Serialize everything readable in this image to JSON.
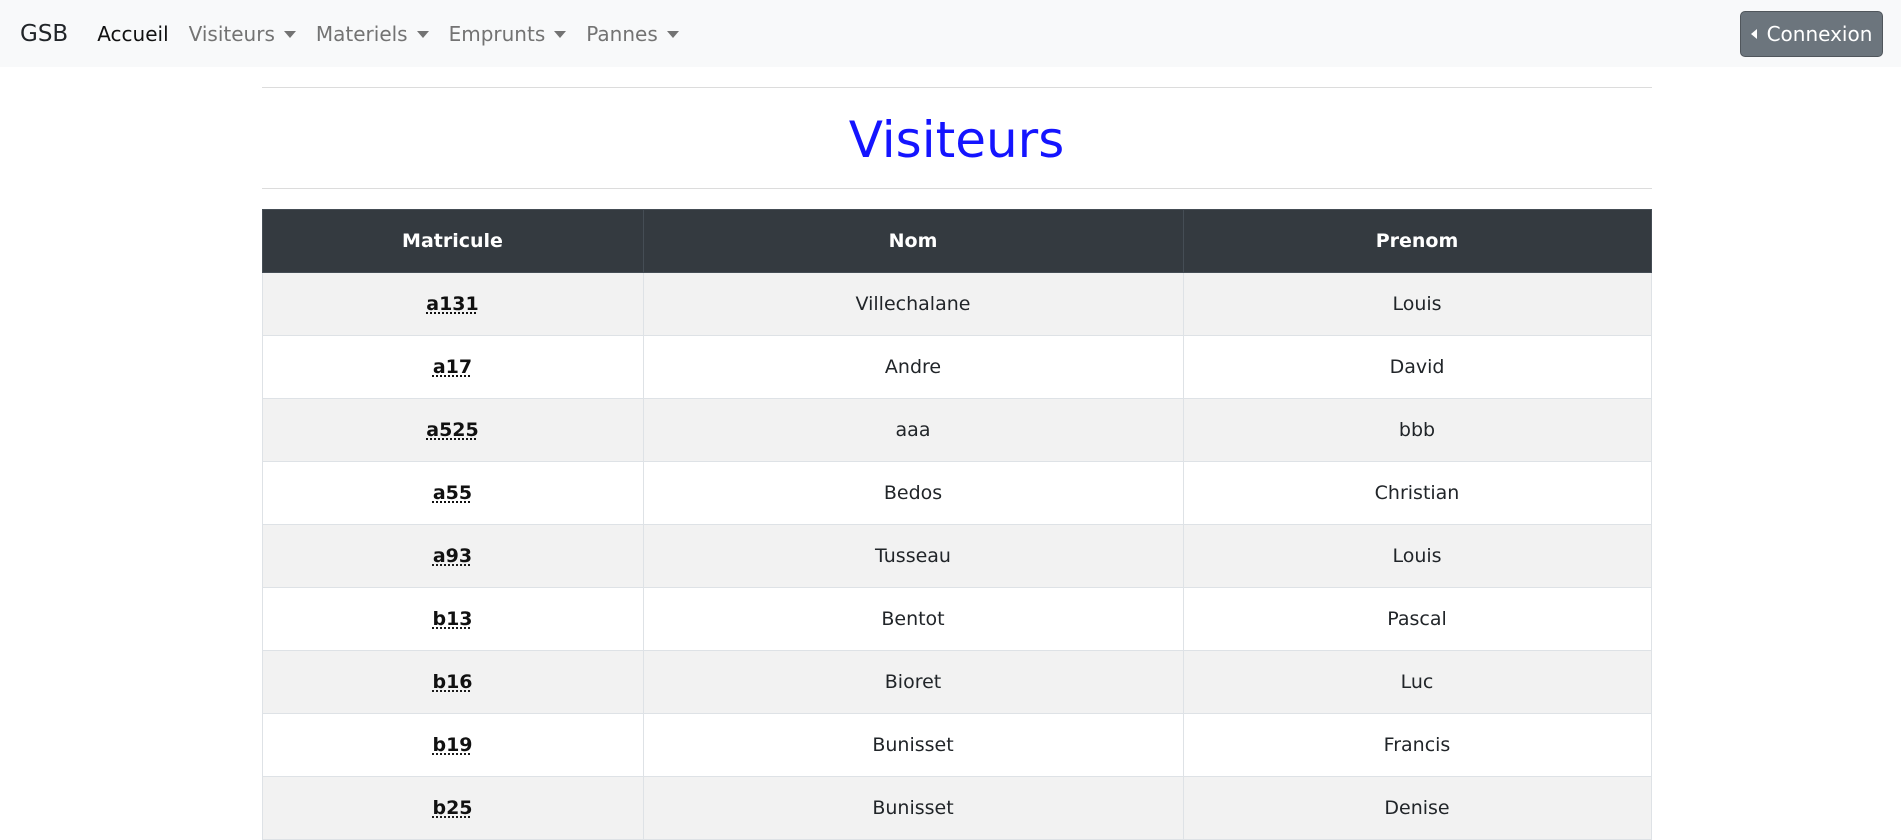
{
  "navbar": {
    "brand": "GSB",
    "items": [
      {
        "label": "Accueil",
        "dropdown": false,
        "active": true
      },
      {
        "label": "Visiteurs",
        "dropdown": true,
        "active": false
      },
      {
        "label": "Materiels",
        "dropdown": true,
        "active": false
      },
      {
        "label": "Emprunts",
        "dropdown": true,
        "active": false
      },
      {
        "label": "Pannes",
        "dropdown": true,
        "active": false
      }
    ],
    "login_label": "Connexion",
    "login_icon": "caret-left-icon"
  },
  "page": {
    "title": "Visiteurs"
  },
  "table": {
    "headers": [
      "Matricule",
      "Nom",
      "Prenom"
    ],
    "rows": [
      {
        "matricule": "a131",
        "nom": "Villechalane",
        "prenom": "Louis"
      },
      {
        "matricule": "a17",
        "nom": "Andre",
        "prenom": "David"
      },
      {
        "matricule": "a525",
        "nom": "aaa",
        "prenom": "bbb"
      },
      {
        "matricule": "a55",
        "nom": "Bedos",
        "prenom": "Christian"
      },
      {
        "matricule": "a93",
        "nom": "Tusseau",
        "prenom": "Louis"
      },
      {
        "matricule": "b13",
        "nom": "Bentot",
        "prenom": "Pascal"
      },
      {
        "matricule": "b16",
        "nom": "Bioret",
        "prenom": "Luc"
      },
      {
        "matricule": "b19",
        "nom": "Bunisset",
        "prenom": "Francis"
      },
      {
        "matricule": "b25",
        "nom": "Bunisset",
        "prenom": "Denise"
      }
    ]
  },
  "colors": {
    "title": "#1414ff",
    "header_bg": "#343a40",
    "navbar_bg": "#f8f9fa",
    "button_bg": "#6c757d"
  }
}
